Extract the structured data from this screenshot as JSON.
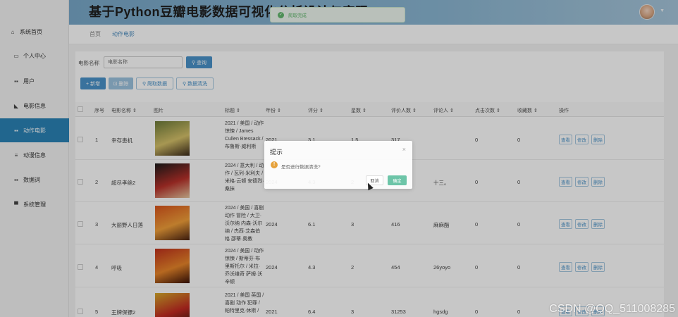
{
  "header": {
    "title": "基于Python豆瓣电影数据可视化分析设计与实现"
  },
  "sidebar": {
    "items": [
      {
        "label": "系统首页",
        "icon": "home-icon",
        "glyph": "⌂"
      },
      {
        "label": "个人中心",
        "icon": "id-card-icon",
        "glyph": "▭"
      },
      {
        "label": "用户",
        "icon": "grid-icon",
        "glyph": "▪▪"
      },
      {
        "label": "电影信息",
        "icon": "film-icon",
        "glyph": "◣"
      },
      {
        "label": "动作电影",
        "icon": "grid-icon",
        "glyph": "▪▪",
        "active": true
      },
      {
        "label": "动漫信息",
        "icon": "list-icon",
        "glyph": "≡"
      },
      {
        "label": "数据词",
        "icon": "grid-icon",
        "glyph": "▪▪"
      },
      {
        "label": "系统管理",
        "icon": "monitor-icon",
        "glyph": "▀"
      }
    ]
  },
  "breadcrumb": {
    "home": "首页",
    "current": "动作电影"
  },
  "search": {
    "label": "电影名称",
    "placeholder": "电影名称",
    "button": "⚲ 查询"
  },
  "toolbar": {
    "add": "+ 新增",
    "delete": "⊡ 删除",
    "crawl": "⚲ 爬取数据",
    "clean": "⚲ 数据清洗"
  },
  "table": {
    "headers": [
      "序号",
      "电影名称 ⇕",
      "图片",
      "标题 ⇕",
      "年份 ⇕",
      "评分 ⇕",
      "星数 ⇕",
      "评价人数 ⇕",
      "评论人 ⇕",
      "点击次数 ⇕",
      "收藏数 ⇕",
      "操作"
    ],
    "actions": {
      "view": "查看",
      "edit": "修改",
      "delete": "删除"
    },
    "rows": [
      {
        "no": "1",
        "name": "幸存患机",
        "title": "2021 / 美国 / 动作 惊悚 / James Cullen Bressack / 布鲁斯·威利斯",
        "year": "2021",
        "score": "3.1",
        "stars": "1.5",
        "votes": "317",
        "reviewer": "",
        "clicks": "0",
        "favorites": "0",
        "poster": [
          "#6d7b3a",
          "#d6c26a",
          "#3b2a1a"
        ]
      },
      {
        "no": "2",
        "name": "超尽孝绝2",
        "title": "2024 / 意大利 / 动作 / 瓦列·米利夫 / 米格·云顿 安德烈·桑抹",
        "year": "2024",
        "score": "4.3",
        "stars": "2",
        "votes": "",
        "reviewer": "十三。",
        "clicks": "0",
        "favorites": "0",
        "poster": [
          "#1b1b1b",
          "#b8312a",
          "#e6c8a0"
        ]
      },
      {
        "no": "3",
        "name": "大丽野人日落",
        "title": "2024 / 美国 / 喜剧 动作 冒险 / 大卫·沃尔纳 内森·沃尔纳 / 杰西·艾森伯格 邵蒂·奥教",
        "year": "2024",
        "score": "6.1",
        "stars": "3",
        "votes": "416",
        "reviewer": "麻麻酯",
        "clicks": "0",
        "favorites": "0",
        "poster": [
          "#d9541c",
          "#f2a03a",
          "#4a2312"
        ]
      },
      {
        "no": "4",
        "name": "呼吸",
        "title": "2024 / 美国 / 动作 惊悚 / 斯蒂芬·布里斯托尔 / 米拉·乔沃维奇 萨姆·沃辛顿",
        "year": "2024",
        "score": "4.3",
        "stars": "2",
        "votes": "454",
        "reviewer": "26yoyo",
        "clicks": "0",
        "favorites": "0",
        "poster": [
          "#c0301c",
          "#e9862a",
          "#3a1208"
        ]
      },
      {
        "no": "5",
        "name": "王牌保镖2",
        "title": "2021 / 美国 英国 / 喜剧 动作 犯罪 / 帕特里克·休斯 /",
        "year": "2021",
        "score": "6.4",
        "stars": "3",
        "votes": "31253",
        "reviewer": "hgsdg",
        "clicks": "0",
        "favorites": "0",
        "poster": [
          "#d6a92a",
          "#c22a22",
          "#2a1a10"
        ]
      }
    ]
  },
  "dialog": {
    "title": "提示",
    "message": "是否进行数据清洗?",
    "cancel": "取消",
    "confirm": "确定",
    "close": "×"
  },
  "toast": {
    "message": "爬取完成"
  },
  "watermark": "CSDN @QQ_511008285"
}
